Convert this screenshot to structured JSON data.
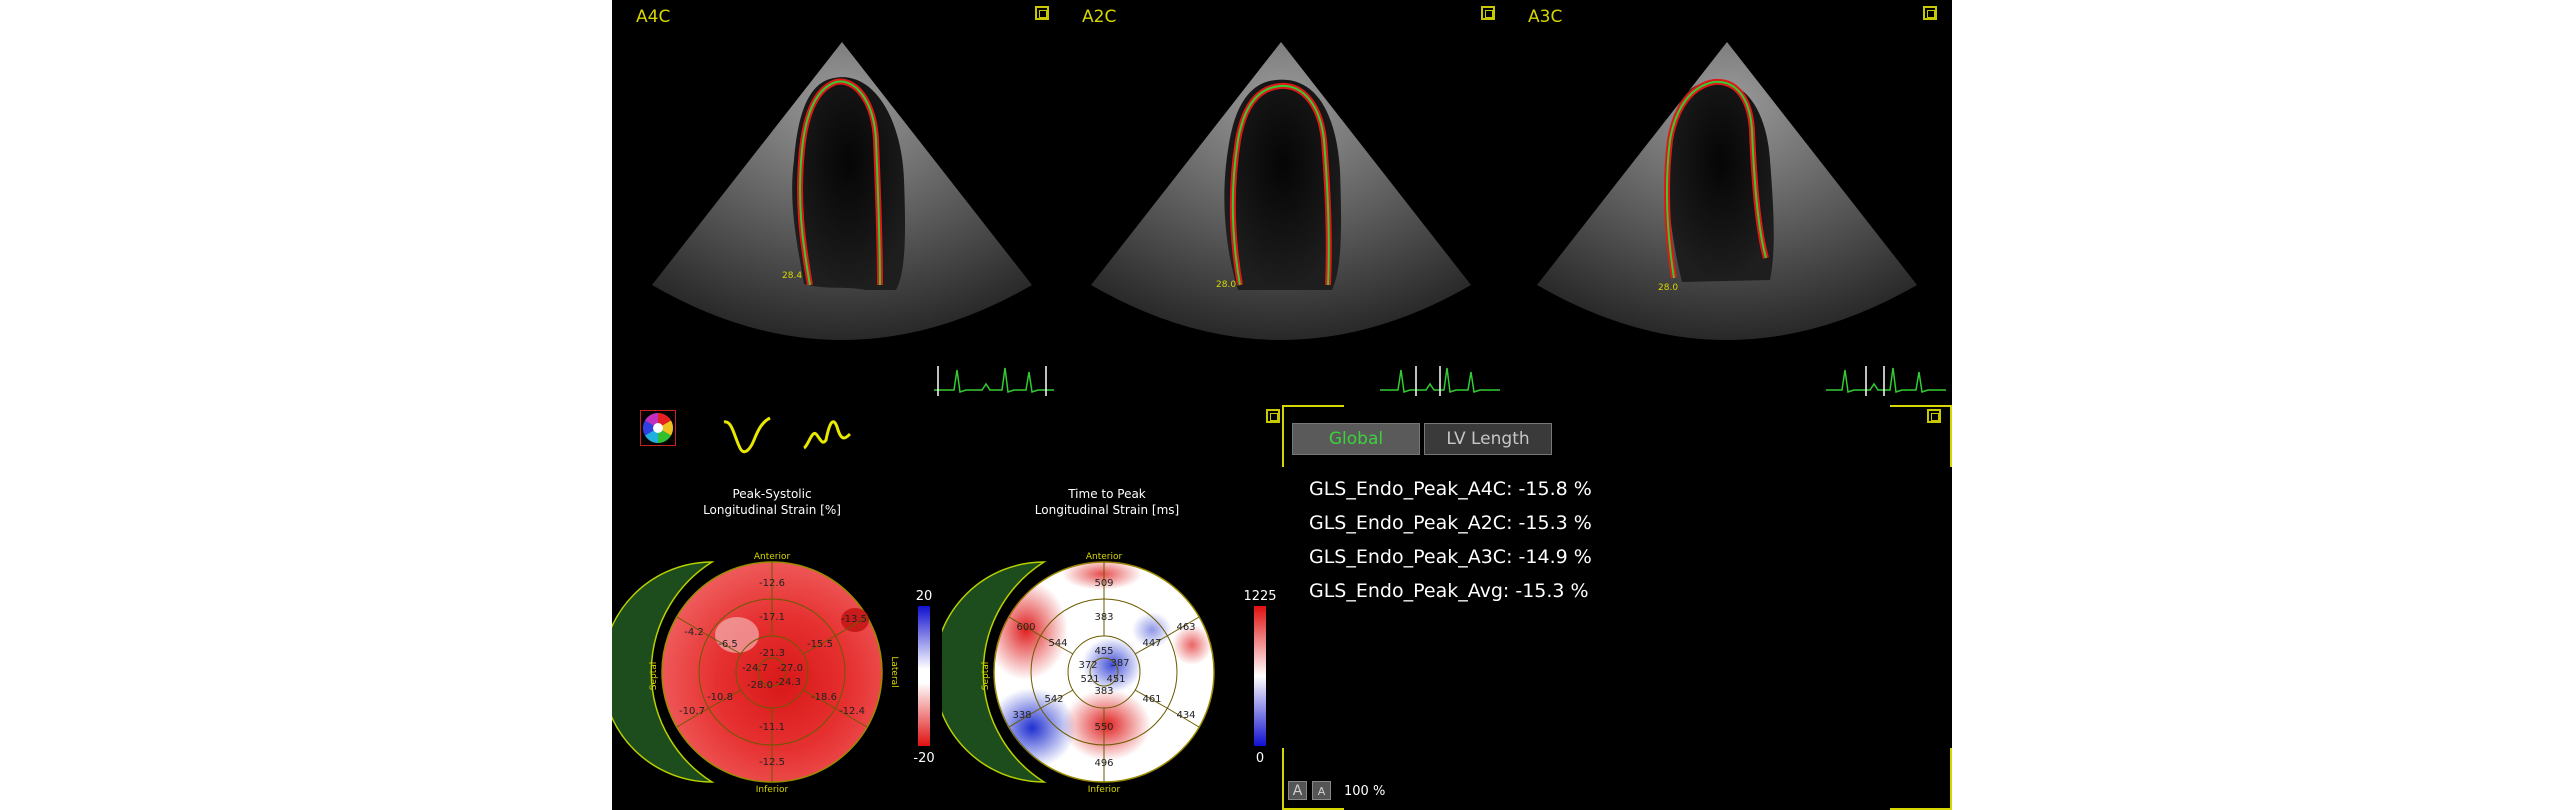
{
  "views": [
    {
      "label": "A4C",
      "annotation": "28.4"
    },
    {
      "label": "A2C",
      "annotation": "28.0"
    },
    {
      "label": "A3C",
      "annotation": "28.0"
    }
  ],
  "toolbar": {
    "icons": [
      "bullseye-color-icon",
      "strain-curve-icon",
      "strain-rate-curve-icon"
    ]
  },
  "strain_plot": {
    "title_line1": "Peak-Systolic",
    "title_line2": "Longitudinal Strain [%]",
    "label_anterior": "Anterior",
    "label_inferior": "Inferior",
    "label_septal": "Septal",
    "label_lateral": "Lateral",
    "scale_max": "20",
    "scale_min": "-20",
    "segments": [
      "-12.6",
      "-17.1",
      "-13.5",
      "-4.2",
      "-6.5",
      "-15.5",
      "-21.3",
      "-24.7",
      "-27.0",
      "-24.3",
      "-28.0",
      "-18.6",
      "-10.8",
      "-10.7",
      "-11.1",
      "-12.4",
      "-12.5"
    ]
  },
  "time_plot": {
    "title_line1": "Time to Peak",
    "title_line2": "Longitudinal Strain [ms]",
    "label_anterior": "Anterior",
    "label_inferior": "Inferior",
    "label_septal": "Septal",
    "scale_max": "1225",
    "scale_min": "0",
    "segments": [
      "509",
      "383",
      "463",
      "600",
      "544",
      "447",
      "455",
      "372",
      "387",
      "521",
      "451",
      "542",
      "383",
      "461",
      "338",
      "550",
      "434",
      "496"
    ]
  },
  "results": {
    "tabs": [
      {
        "label": "Global",
        "active": true
      },
      {
        "label": "LV Length",
        "active": false
      }
    ],
    "gls": [
      {
        "name": "GLS_Endo_Peak_A4C:",
        "value": "-15.8 %"
      },
      {
        "name": "GLS_Endo_Peak_A2C:",
        "value": "-15.3 %"
      },
      {
        "name": "GLS_Endo_Peak_A3C:",
        "value": "-14.9 %"
      },
      {
        "name": "GLS_Endo_Peak_Avg:",
        "value": "-15.3 %"
      }
    ],
    "zoom_a_large": "A",
    "zoom_a_small": "A",
    "zoom_level": "100 %"
  },
  "colors": {
    "accent": "#d6d600",
    "endocardium": "#e01818",
    "trace": "#33cc33",
    "active_tab_text": "#3cd23c"
  }
}
